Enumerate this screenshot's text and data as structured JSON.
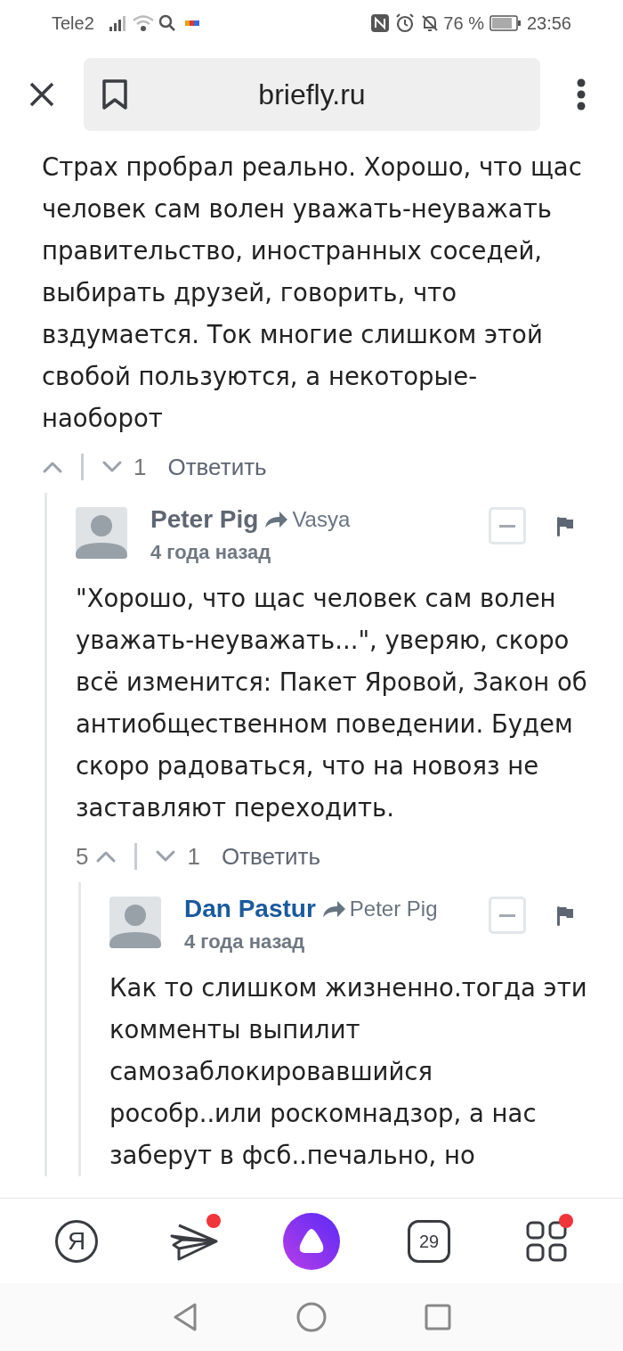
{
  "status_bar": {
    "carrier": "Tele2",
    "battery": "76 %",
    "time": "23:56"
  },
  "browser": {
    "address": "briefly.ru"
  },
  "comments": [
    {
      "text": "Страх пробрал реально. Хорошо, что щас человек сам волен уважать-неуважать правительство, иностранных соседей, выбирать друзей, говорить, что вздумается. Ток многие слишком этой свобой пользуются, а некоторые-наоборот",
      "down_count": "1",
      "reply": "Ответить",
      "children": [
        {
          "author": "Peter Pig",
          "highlighted": false,
          "reply_to": "Vasya",
          "date": "4 года назад",
          "text": "\"Хорошо, что щас человек сам волен уважать-неуважать...\", уверяю, скоро всё изменится: Пакет Яровой, Закон об антиобщественном поведении. Будем скоро радоваться, что на новояз не заставляют переходить.",
          "up_count": "5",
          "down_count": "1",
          "reply": "Ответить",
          "children": [
            {
              "author": "Dan Pastur",
              "highlighted": true,
              "reply_to": "Peter Pig",
              "date": "4 года назад",
              "text": "Как то слишком жизненно.тогда эти комменты выпилит самозаблокировавшийся рособр..или роскомнадзор, а нас заберут в фсб..печально, но"
            }
          ]
        }
      ]
    }
  ],
  "toolbar": [
    {
      "kind": "yandex",
      "label": "Я",
      "badge": false
    },
    {
      "kind": "messenger",
      "badge": true
    },
    {
      "kind": "alice",
      "badge": false
    },
    {
      "kind": "tabs",
      "label": "29",
      "badge": false
    },
    {
      "kind": "services",
      "badge": true
    }
  ]
}
